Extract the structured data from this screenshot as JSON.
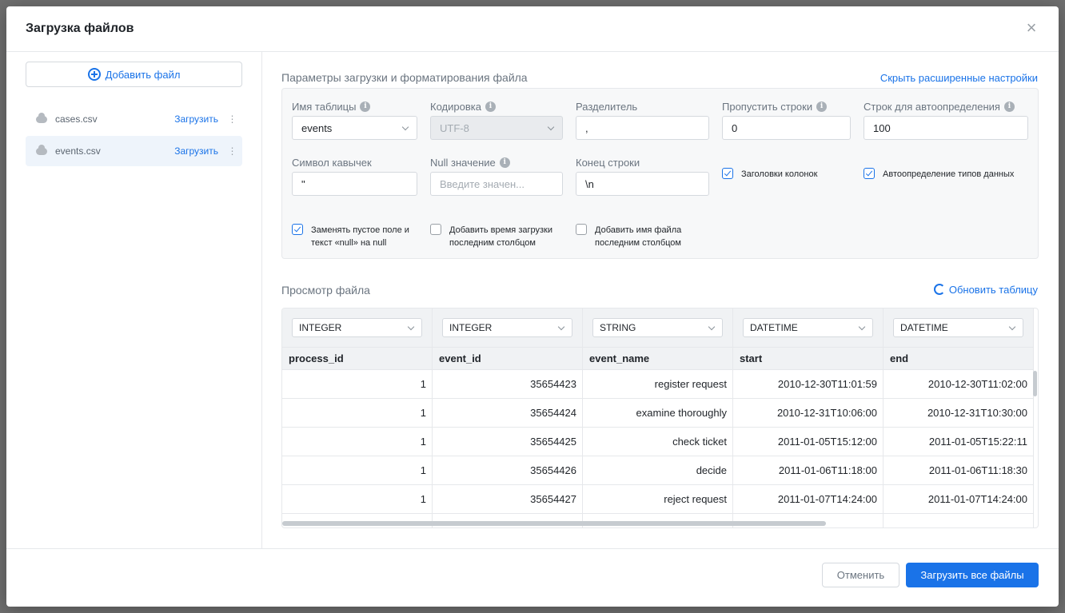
{
  "modal": {
    "title": "Загрузка файлов",
    "close_symbol": "×"
  },
  "sidebar": {
    "add_file_label": "Добавить файл",
    "files": [
      {
        "name": "cases.csv",
        "action": "Загрузить",
        "active": false
      },
      {
        "name": "events.csv",
        "action": "Загрузить",
        "active": true
      }
    ]
  },
  "params": {
    "title": "Параметры загрузки и форматирования файла",
    "hide_advanced_link": "Скрыть расширенные настройки",
    "table_name": {
      "label": "Имя таблицы",
      "value": "events"
    },
    "encoding": {
      "label": "Кодировка",
      "value": "UTF-8"
    },
    "delimiter": {
      "label": "Разделитель",
      "value": ","
    },
    "skip_rows": {
      "label": "Пропустить строки",
      "value": "0"
    },
    "autodetect_rows": {
      "label": "Строк для автоопределения",
      "value": "100"
    },
    "quote_char": {
      "label": "Символ кавычек",
      "value": "\""
    },
    "null_value": {
      "label": "Null значение",
      "placeholder": "Введите значен..."
    },
    "line_end": {
      "label": "Конец строки",
      "value": "\\n"
    },
    "checkboxes": {
      "column_headers": {
        "label": "Заголовки колонок",
        "checked": true
      },
      "autodetect_types": {
        "label": "Автоопределение типов данных",
        "checked": true
      },
      "replace_empty_line1": "Заменять пустое поле и",
      "replace_empty_line2": "текст «null» на null",
      "add_load_time_line1": "Добавить время загрузки",
      "add_load_time_line2": "последним столбцом",
      "add_file_name_line1": "Добавить имя файла",
      "add_file_name_line2": "последним столбцом"
    }
  },
  "preview": {
    "title": "Просмотр файла",
    "refresh_link": "Обновить таблицу",
    "columns": [
      {
        "type": "INTEGER",
        "name": "process_id"
      },
      {
        "type": "INTEGER",
        "name": "event_id"
      },
      {
        "type": "STRING",
        "name": "event_name"
      },
      {
        "type": "DATETIME",
        "name": "start"
      },
      {
        "type": "DATETIME",
        "name": "end"
      }
    ],
    "rows": [
      [
        "1",
        "35654423",
        "register request",
        "2010-12-30T11:01:59",
        "2010-12-30T11:02:00"
      ],
      [
        "1",
        "35654424",
        "examine thoroughly",
        "2010-12-31T10:06:00",
        "2010-12-31T10:30:00"
      ],
      [
        "1",
        "35654425",
        "check ticket",
        "2011-01-05T15:12:00",
        "2011-01-05T15:22:11"
      ],
      [
        "1",
        "35654426",
        "decide",
        "2011-01-06T11:18:00",
        "2011-01-06T11:18:30"
      ],
      [
        "1",
        "35654427",
        "reject request",
        "2011-01-07T14:24:00",
        "2011-01-07T14:24:00"
      ]
    ]
  },
  "footer": {
    "cancel_label": "Отменить",
    "upload_all_label": "Загрузить все файлы"
  },
  "colors": {
    "accent": "#1a73e8",
    "text": "#1f2328",
    "muted": "#6b7580",
    "border": "#e6e8eb"
  }
}
